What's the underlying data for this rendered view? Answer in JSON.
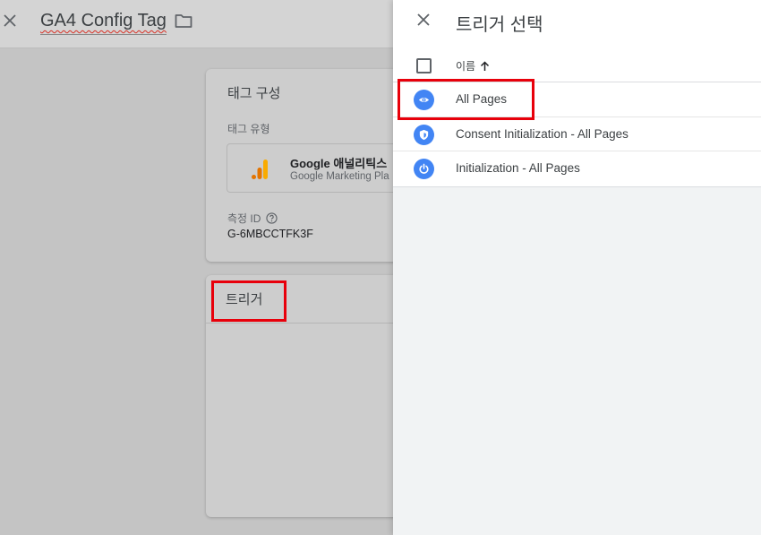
{
  "topbar": {
    "tag_title": "GA4 Config Tag"
  },
  "config_card": {
    "title": "태그 구성",
    "tag_type_label": "태그 유형",
    "tag_type_name": "Google 애널리틱스",
    "tag_type_sub": "Google Marketing Pla",
    "measurement_label": "측정 ID",
    "measurement_value": "G-6MBCCTFK3F"
  },
  "trigger_card": {
    "title": "트리거"
  },
  "panel": {
    "title": "트리거 선택",
    "column_name": "이름",
    "rows": [
      {
        "label": "All Pages",
        "icon": "eye-icon"
      },
      {
        "label": "Consent Initialization - All Pages",
        "icon": "shield-icon"
      },
      {
        "label": "Initialization - All Pages",
        "icon": "power-icon"
      }
    ]
  },
  "colors": {
    "accent_blue": "#4285f4",
    "highlight_red": "#e8000b",
    "analytics_orange": "#f9ab00",
    "analytics_dark_orange": "#e37400"
  }
}
